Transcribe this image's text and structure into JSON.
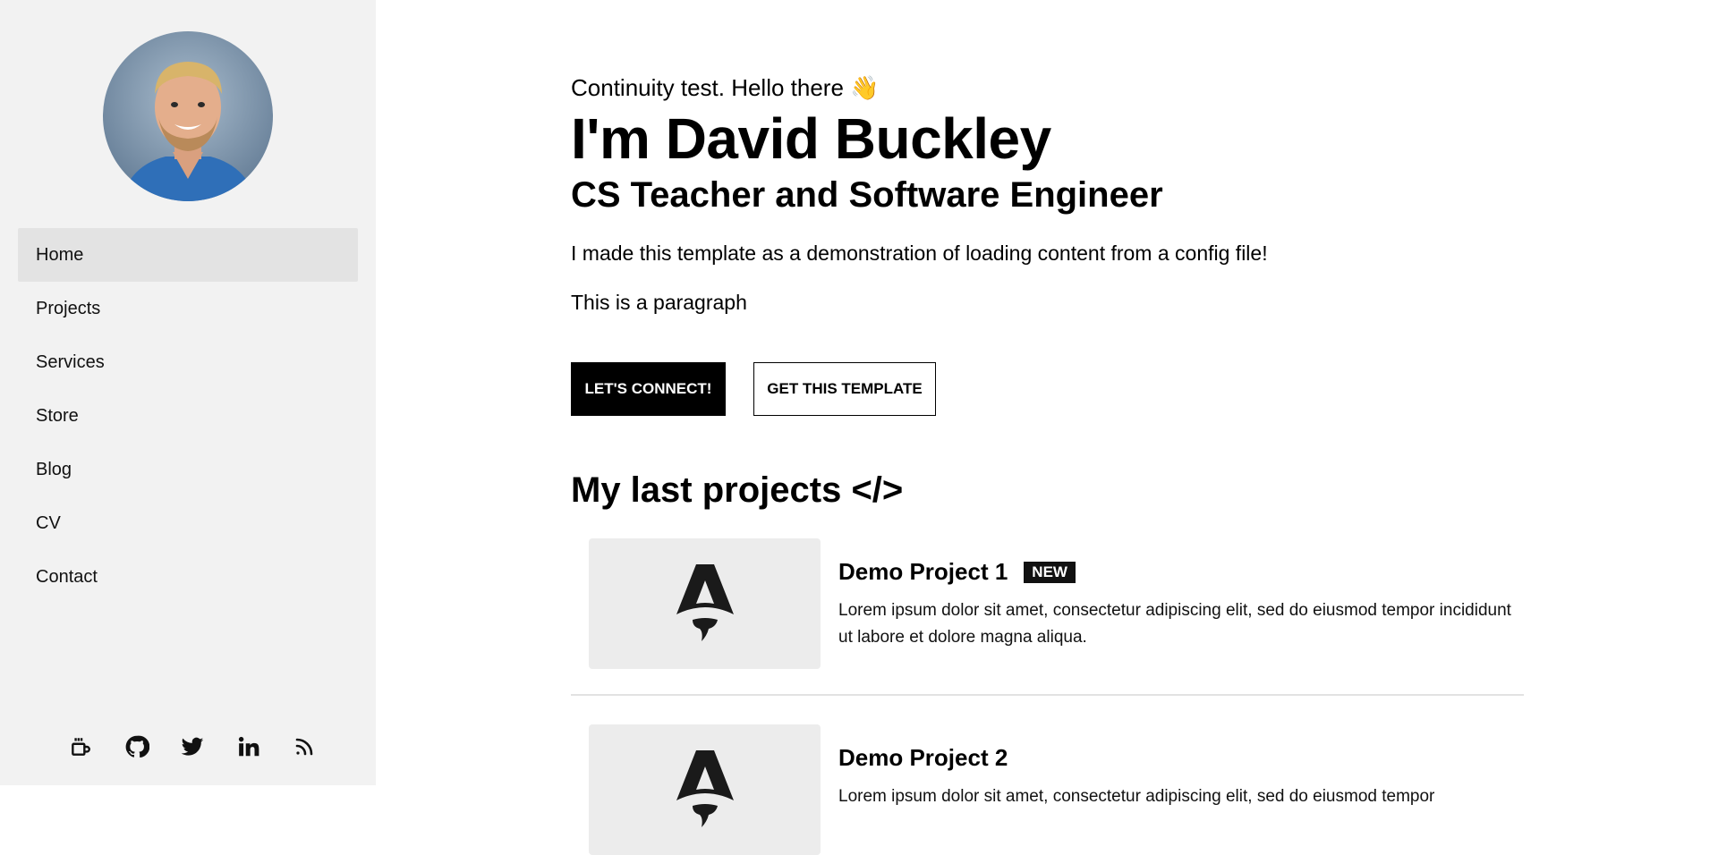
{
  "sidebar": {
    "avatar_alt": "David Buckley",
    "nav": [
      {
        "label": "Home",
        "active": true
      },
      {
        "label": "Projects"
      },
      {
        "label": "Services"
      },
      {
        "label": "Store"
      },
      {
        "label": "Blog"
      },
      {
        "label": "CV"
      },
      {
        "label": "Contact"
      }
    ],
    "socials": [
      {
        "icon": "coffee-icon"
      },
      {
        "icon": "github-icon"
      },
      {
        "icon": "twitter-icon"
      },
      {
        "icon": "linkedin-icon"
      },
      {
        "icon": "rss-icon"
      }
    ]
  },
  "hero": {
    "greeting": "Continuity test. Hello there 👋",
    "name": "I'm David Buckley",
    "role": "CS Teacher and Software Engineer",
    "description": "I made this template as a demonstration of loading content from a config file!",
    "paragraph": "This is a paragraph",
    "primary_button": "LET'S CONNECT!",
    "secondary_button": "GET THIS TEMPLATE"
  },
  "projects_section": {
    "title": "My last projects </>",
    "projects": [
      {
        "title": "Demo Project 1",
        "badge": "NEW",
        "description": "Lorem ipsum dolor sit amet, consectetur adipiscing elit, sed do eiusmod tempor incididunt ut labore et dolore magna aliqua.",
        "thumbnail_icon": "astro-logo-icon"
      },
      {
        "title": "Demo Project 2",
        "description": "Lorem ipsum dolor sit amet, consectetur adipiscing elit, sed do eiusmod tempor",
        "thumbnail_icon": "astro-logo-icon"
      }
    ]
  },
  "colors": {
    "sidebar_bg": "#f2f2f2",
    "active_nav_bg": "#e3e3e3",
    "primary": "#000000",
    "thumb_bg": "#ececec"
  }
}
